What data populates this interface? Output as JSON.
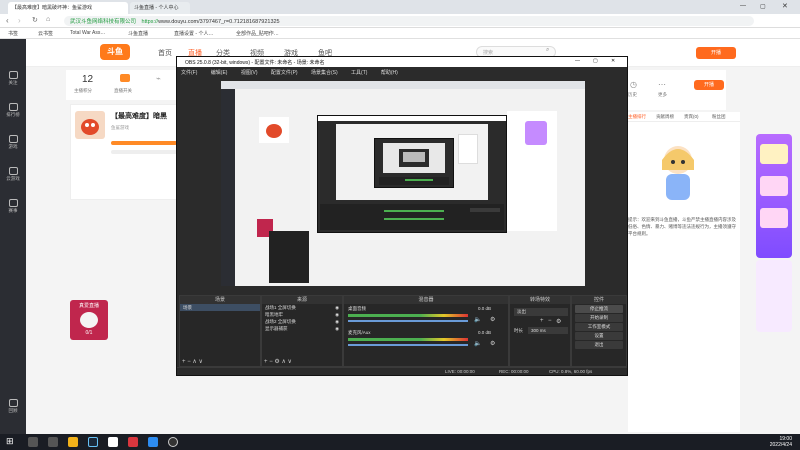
{
  "browser": {
    "tab_active": "【最高难度】暗黑破坏神：鱼鲨游戏",
    "tab_second": "斗鱼直播 - 个人中心",
    "url_cert": "武汉斗鱼网络科技有限公司",
    "url_https": "https://",
    "url_rest": "www.douyu.com/3797467_r=0.712181687921325",
    "bookmarks": [
      "书签",
      "云书签",
      "Total War Ass…",
      "斗鱼直播",
      "直播设置 - 个人…",
      "全部作品_贴吧作…"
    ]
  },
  "douyu": {
    "logo": "斗鱼",
    "nav": [
      "首页",
      "直播",
      "分类",
      "视频",
      "游戏",
      "鱼吧"
    ],
    "active_nav": "直播",
    "search_placeholder": "搜索",
    "open_live": "开播",
    "right_nav": [
      "历史",
      "更多"
    ],
    "room_title": "【最高难度】暗黑",
    "streamer_name": "鱼鲨游戏",
    "follow_count": "12",
    "follow_label": "主播积分",
    "anchor_tag": "直播开关",
    "sidebar": [
      "关注",
      "排行榜",
      "游戏",
      "云游戏",
      "赛事",
      "回顾"
    ],
    "notice": "提示：欢迎来到斗鱼直播，斗鱼严禁主播直播内容涉及低俗、色情、暴力、赌博等违法违规行为，主播须遵守平台规则。",
    "tabs": [
      "主播排行",
      "贡献周榜",
      "贵宾(0)",
      "粉丝团"
    ],
    "live_badge": "真爱直播",
    "live_count": "0/1"
  },
  "obs": {
    "title": "OBS 25.0.8 (32-bit, windows) - 配置文件: 未命名 - 场景: 未命名",
    "menu": [
      "文件(F)",
      "编辑(E)",
      "视图(V)",
      "配置文件(P)",
      "场景集合(S)",
      "工具(T)",
      "帮助(H)"
    ],
    "docks": {
      "scenes": "场景",
      "sources": "来源",
      "mixer": "混音器",
      "transitions": "转场特效",
      "controls": "控件"
    },
    "scene_items": [
      "场景"
    ],
    "source_items": [
      "战场1 全屏切换",
      "暗黑地牢",
      "战场2 全屏切换",
      "显示器捕获"
    ],
    "mixer_tracks": [
      {
        "name": "桌面音频",
        "db": "0.0 dB"
      },
      {
        "name": "麦克风/Aux",
        "db": "0.0 dB"
      }
    ],
    "transition_name": "淡出",
    "duration_label": "时长",
    "duration_value": "300 ms",
    "controls": [
      "停止推流",
      "开始录制",
      "工作室模式",
      "设置",
      "退出"
    ],
    "status": [
      "LIVE: 00:00:00",
      "REC: 00:00:00",
      "CPU: 0.8%, 60.00 fps"
    ]
  },
  "taskbar": {
    "time": "19:00",
    "date": "2022/4/24"
  }
}
